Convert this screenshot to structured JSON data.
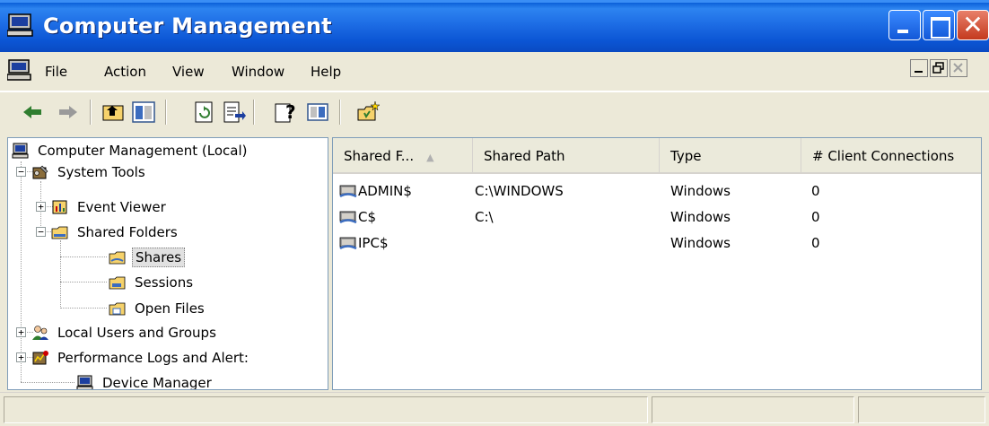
{
  "window": {
    "title": "Computer Management",
    "close_glyph": "✕"
  },
  "menu": {
    "items": [
      "File",
      "Action",
      "View",
      "Window",
      "Help"
    ]
  },
  "toolbar": {
    "buttons": [
      "back-icon",
      "forward-icon",
      "up-one-level-icon",
      "show-hide-console-tree-icon",
      "refresh-icon",
      "export-list-icon",
      "help-icon",
      "show-hide-action-pane-icon",
      "new-file-share-icon"
    ]
  },
  "tree": {
    "root": "Computer Management (Local)",
    "system_tools": "System Tools",
    "event_viewer": "Event Viewer",
    "shared_folders": "Shared Folders",
    "shares": "Shares",
    "sessions": "Sessions",
    "open_files": "Open Files",
    "local_users": "Local Users and Groups",
    "perf_logs": "Performance Logs and Alert:",
    "device_manager": "Device Manager",
    "expander_plus": "+",
    "expander_minus": "−"
  },
  "list": {
    "columns": [
      "Shared F...",
      "Shared Path",
      "Type",
      "# Client Connections"
    ],
    "sort_indicator": "▲",
    "rows": [
      {
        "name": "ADMIN$",
        "path": "C:\\WINDOWS",
        "type": "Windows",
        "connections": "0"
      },
      {
        "name": "C$",
        "path": "C:\\",
        "type": "Windows",
        "connections": "0"
      },
      {
        "name": "IPC$",
        "path": "",
        "type": "Windows",
        "connections": "0"
      }
    ]
  },
  "colors": {
    "titlebar": "#0a55d4",
    "window_bg": "#ece9d8",
    "selection": "#e1e1e1"
  }
}
